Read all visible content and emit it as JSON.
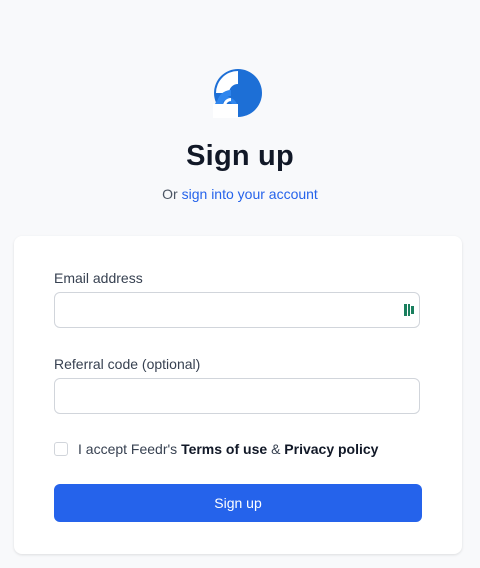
{
  "brand": {
    "logo_icon": "feedr-logo-icon",
    "color": "#2563eb"
  },
  "header": {
    "title": "Sign up",
    "subtitle_prefix": "Or",
    "signin_link": "sign into your account"
  },
  "form": {
    "email_label": "Email address",
    "email_value": "",
    "email_extension_icon": "password-manager-icon",
    "referral_label": "Referral code (optional)",
    "referral_value": "",
    "terms_checked": false,
    "accept_prefix": "I accept Feedr's",
    "terms_link": "Terms of use",
    "ampersand": "&",
    "privacy_link": "Privacy policy",
    "submit_label": "Sign up"
  },
  "colors": {
    "accent": "#2563eb",
    "title": "#111827",
    "page_bg": "#f8f9fb"
  }
}
